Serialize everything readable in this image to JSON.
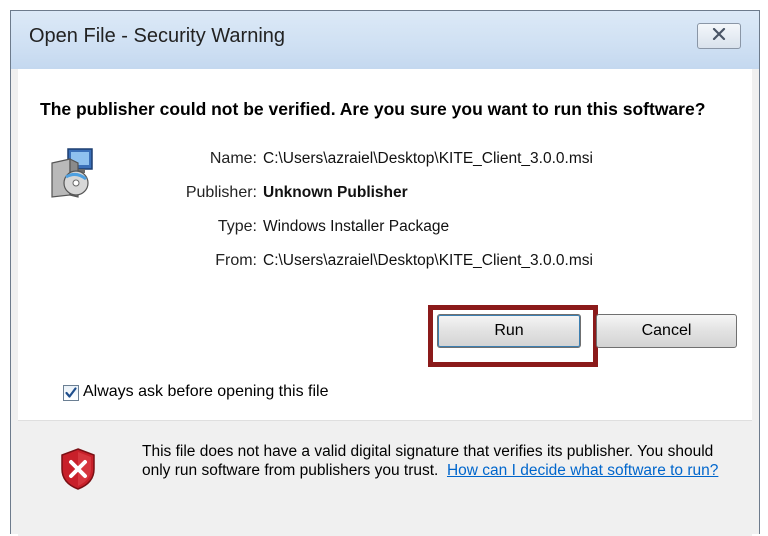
{
  "window": {
    "title": "Open File - Security Warning"
  },
  "headline": "The publisher could not be verified.  Are you sure you want to run this software?",
  "details": [
    {
      "label": "Name:",
      "value": "C:\\Users\\azraiel\\Desktop\\KITE_Client_3.0.0.msi"
    },
    {
      "label": "Publisher:",
      "value": "Unknown Publisher"
    },
    {
      "label": "Type:",
      "value": "Windows Installer Package"
    },
    {
      "label": "From:",
      "value": "C:\\Users\\azraiel\\Desktop\\KITE_Client_3.0.0.msi"
    }
  ],
  "buttons": {
    "run": "Run",
    "cancel": "Cancel"
  },
  "checkbox": {
    "label": "Always ask before opening this file",
    "checked": true
  },
  "footer": {
    "text": "This file does not have a valid digital signature that verifies its publisher. You should only run software from publishers you trust.",
    "link": "How can I decide what software to run?"
  },
  "colors": {
    "highlight": "#8b1a1a",
    "link": "#0066cc",
    "shield": "#c8202a"
  },
  "icons": {
    "close": "close-icon",
    "app": "installer-package-icon",
    "warning": "security-shield-icon"
  }
}
